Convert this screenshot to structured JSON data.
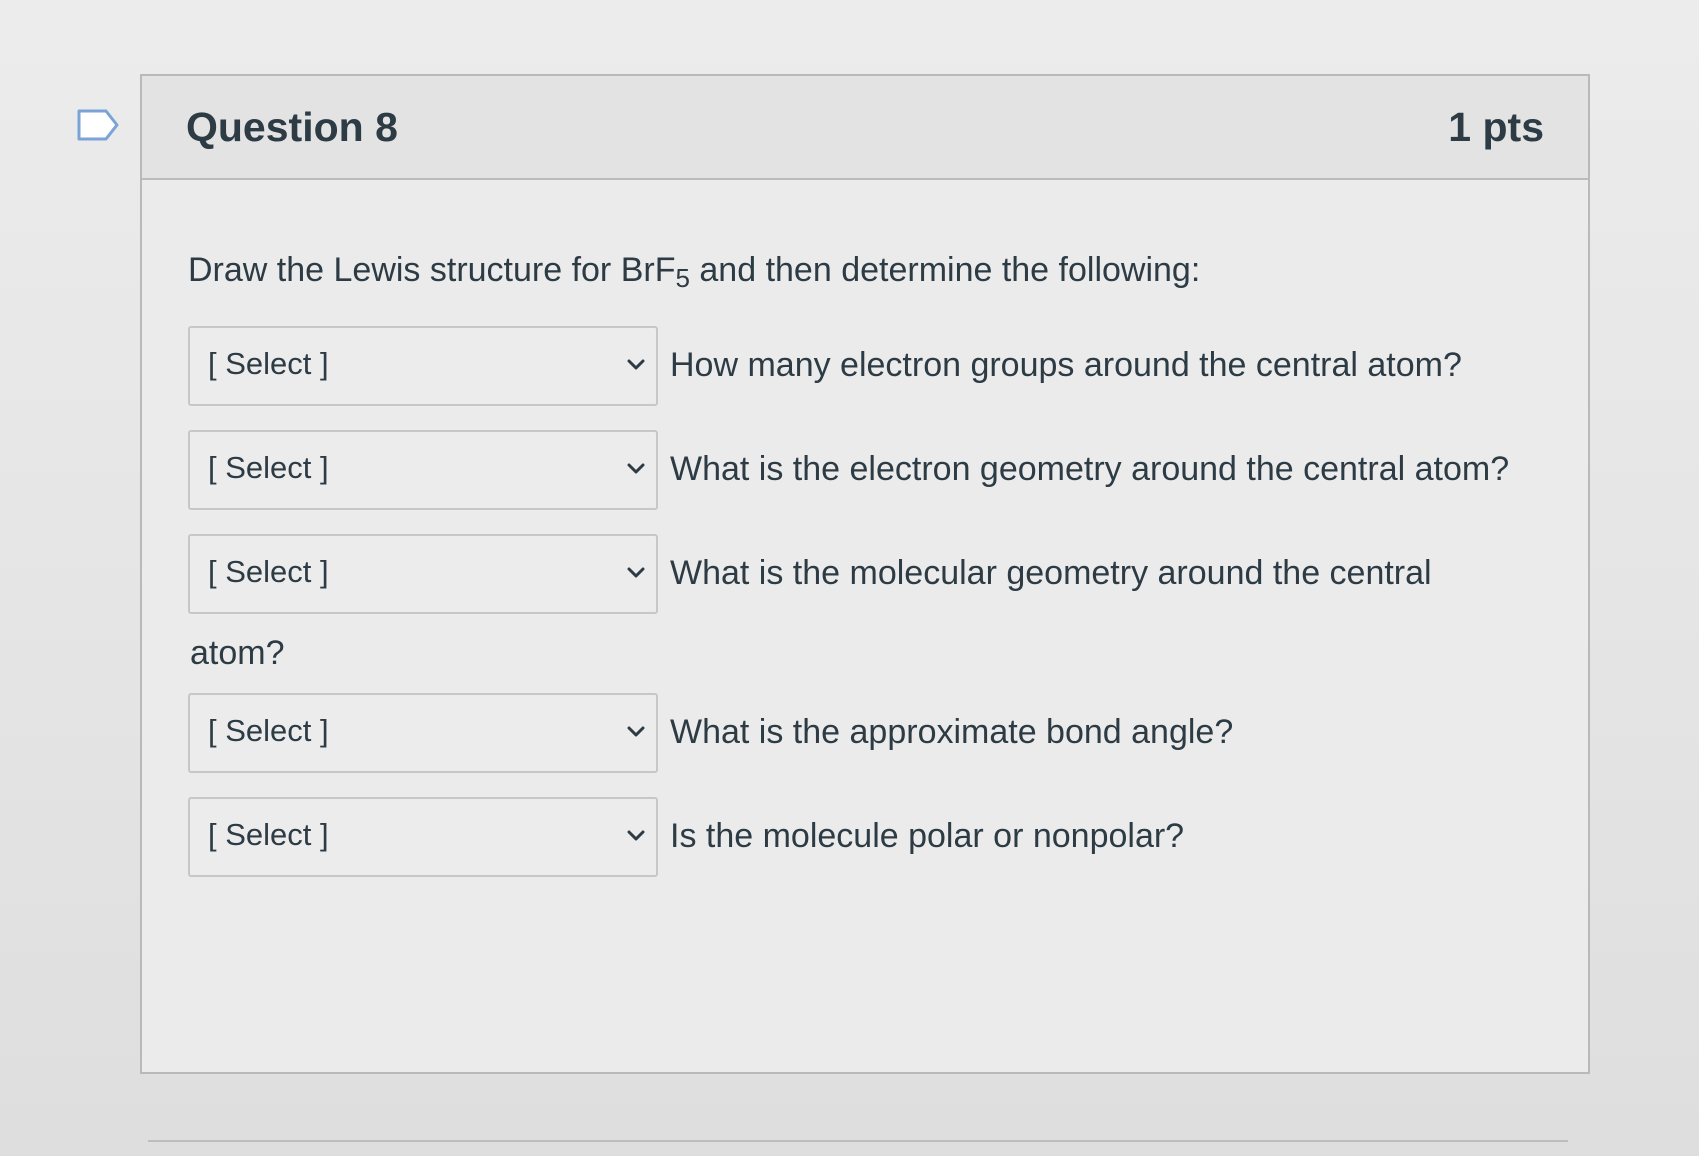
{
  "question": {
    "title": "Question 8",
    "points": "1 pts",
    "prompt_prefix": "Draw the Lewis structure for BrF",
    "prompt_subscript": "5",
    "prompt_suffix": " and then determine the following:"
  },
  "rows": [
    {
      "select_value": "[ Select ]",
      "question": "How many electron groups around the central atom?"
    },
    {
      "select_value": "[ Select ]",
      "question": "What is the electron geometry around the central atom?"
    },
    {
      "select_value": "[ Select ]",
      "question": "What is the molecular geometry around the central",
      "continuation": "atom?"
    },
    {
      "select_value": "[ Select ]",
      "question": "What is the approximate bond angle?"
    },
    {
      "select_value": "[ Select ]",
      "question": "Is the molecule polar or nonpolar?"
    }
  ],
  "icons": {
    "flag": "flag-icon",
    "dropdown": "chevron-down-icon"
  },
  "colors": {
    "text": "#2d3b45",
    "border": "#c7c7c7",
    "background": "#ebebeb"
  }
}
